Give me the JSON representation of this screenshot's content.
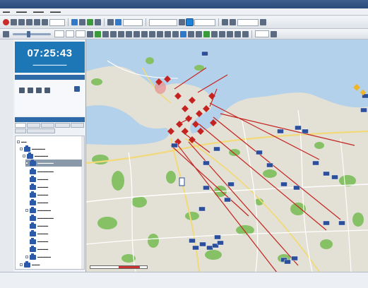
{
  "clock": {
    "time": "07:25:43"
  },
  "map": {
    "colors": {
      "sea": "#b3d1ea",
      "land": "#e2dfd5",
      "green": "#86c265",
      "road": "#ffffff",
      "yellow_road": "#f2d97a",
      "track": "#c4231f",
      "unit": "#2b4f9a"
    },
    "icons": [
      "unit-icon",
      "enemy-unit-icon",
      "track-line"
    ]
  },
  "toolbar": {
    "icons": [
      "record-icon",
      "play-icon",
      "pause-icon",
      "stop-icon",
      "zoom-icon",
      "select-icon",
      "measure-icon",
      "draw-icon",
      "layer-icon"
    ]
  },
  "tree": {
    "icons": [
      "folder-icon",
      "unit-icon"
    ]
  }
}
